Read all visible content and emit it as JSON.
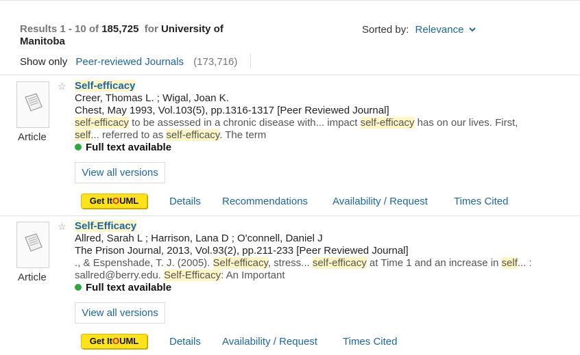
{
  "summary": {
    "results_prefix": "Results 1 - 10 of",
    "total": "185,725",
    "for_label": "for",
    "institution": "University of Manitoba"
  },
  "sort": {
    "label": "Sorted by:",
    "value": "Relevance"
  },
  "filter": {
    "show_only": "Show only",
    "facet": "Peer-reviewed Journals",
    "facet_count": "(173,716)"
  },
  "records": [
    {
      "type": "Article",
      "title": "Self-efficacy",
      "authors": "Creer, Thomas L. ; Wigal, Joan K.",
      "source": "Chest, May 1993, Vol.103(5), pp.1316-1317 [Peer Reviewed Journal]",
      "snippet_l1": [
        {
          "text": "self-efficacy",
          "hl": true
        },
        {
          "text": " to be assessed in a chronic disease with... impact ",
          "hl": false
        },
        {
          "text": "self-efficacy",
          "hl": true
        },
        {
          "text": " has on our lives. First,",
          "hl": false
        }
      ],
      "snippet_l2": [
        {
          "text": "self",
          "hl": true
        },
        {
          "text": "... referred to as ",
          "hl": false
        },
        {
          "text": "self-efficacy",
          "hl": true
        },
        {
          "text": ". The term",
          "hl": false
        }
      ],
      "fulltext": "Full text available",
      "versions": "View all versions",
      "getit": "Get It UML",
      "actions": [
        "Details",
        "Recommendations",
        "Availability / Request",
        "Times Cited"
      ]
    },
    {
      "type": "Article",
      "title": "Self-Efficacy",
      "authors": "Allred, Sarah L ; Harrison, Lana D ; O'connell, Daniel J",
      "source": "The Prison Journal, 2013, Vol.93(2), pp.211-233 [Peer Reviewed Journal]",
      "snippet_l1": [
        {
          "text": "., & Espenshade, T. J. (2005). ",
          "hl": false
        },
        {
          "text": "Self-efficacy",
          "hl": true
        },
        {
          "text": ", stress... ",
          "hl": false
        },
        {
          "text": "self-efficacy",
          "hl": true
        },
        {
          "text": " at Time 1 and an increase in ",
          "hl": false
        },
        {
          "text": "self",
          "hl": true
        },
        {
          "text": "... :",
          "hl": false
        }
      ],
      "snippet_l2": [
        {
          "text": "sallred@berry.edu. ",
          "hl": false
        },
        {
          "text": "Self-Efficacy",
          "hl": true
        },
        {
          "text": ": An Important",
          "hl": false
        }
      ],
      "fulltext": "Full text available",
      "versions": "View all versions",
      "getit": "Get It UML",
      "actions": [
        "Details",
        "Availability / Request",
        "Times Cited"
      ]
    }
  ],
  "icons": {
    "thumbnail": "document-page-icon",
    "favorite": "star-outline-icon",
    "sort_toggle": "chevron-down-icon",
    "availability": "green-dot-icon"
  },
  "colors": {
    "link": "#1a66a8",
    "highlight": "#fdf6c4",
    "getit_bg": "#ffe31a",
    "available": "#2ea83a"
  }
}
